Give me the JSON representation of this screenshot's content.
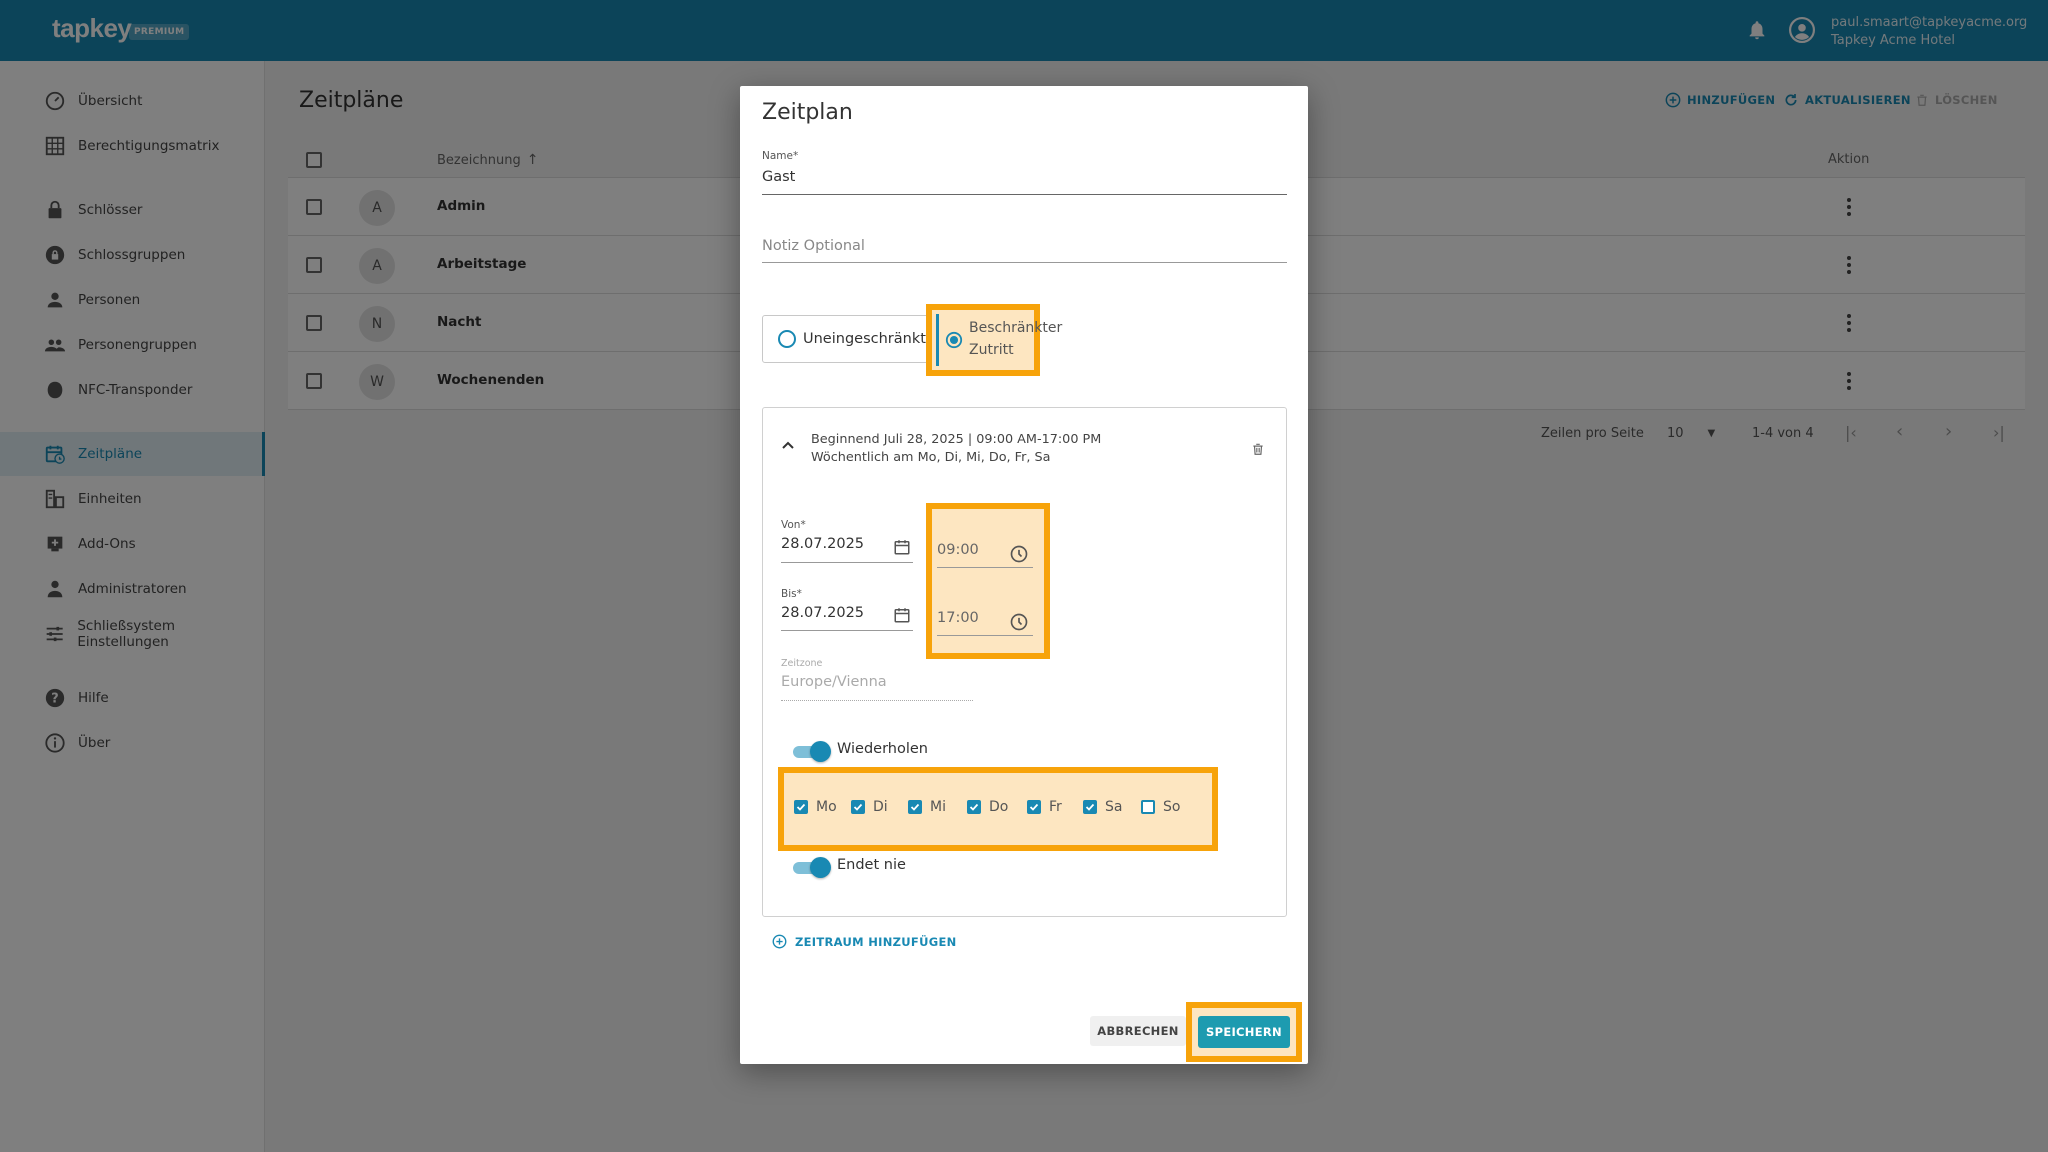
{
  "app": {
    "logo": "tapkey",
    "logo_badge": "PREMIUM",
    "user_email": "paul.smaart@tapkeyacme.org",
    "user_org": "Tapkey Acme Hotel"
  },
  "sidebar": {
    "items": [
      {
        "label": "Übersicht",
        "icon": "speedometer-icon"
      },
      {
        "label": "Berechtigungsmatrix",
        "icon": "grid-icon"
      },
      {
        "label": "Schlösser",
        "icon": "lock-icon"
      },
      {
        "label": "Schlossgruppen",
        "icon": "lock-group-icon"
      },
      {
        "label": "Personen",
        "icon": "person-icon"
      },
      {
        "label": "Personengruppen",
        "icon": "people-icon"
      },
      {
        "label": "NFC-Transponder",
        "icon": "transponder-icon"
      },
      {
        "label": "Zeitpläne",
        "icon": "calendar-clock-icon",
        "active": true
      },
      {
        "label": "Einheiten",
        "icon": "units-icon"
      },
      {
        "label": "Add-Ons",
        "icon": "addon-icon"
      },
      {
        "label": "Administratoren",
        "icon": "admin-icon"
      },
      {
        "label": "Schließsystem Einstellungen",
        "icon": "sliders-icon"
      },
      {
        "label": "Hilfe",
        "icon": "help-icon"
      },
      {
        "label": "Über",
        "icon": "info-icon"
      }
    ]
  },
  "main": {
    "title": "Zeitpläne",
    "actions": {
      "add": "HINZUFÜGEN",
      "refresh": "AKTUALISIEREN",
      "delete": "LÖSCHEN"
    },
    "columns": {
      "name": "Bezeichnung",
      "action": "Aktion"
    },
    "rows": [
      {
        "initial": "A",
        "name": "Admin"
      },
      {
        "initial": "A",
        "name": "Arbeitstage"
      },
      {
        "initial": "N",
        "name": "Nacht"
      },
      {
        "initial": "W",
        "name": "Wochenenden"
      }
    ],
    "pagination": {
      "rows_per_page_label": "Zeilen pro Seite",
      "rows_per_page": "10",
      "range": "1-4 von 4"
    }
  },
  "dialog": {
    "title": "Zeitplan",
    "name_label": "Name*",
    "name_value": "Gast",
    "note_placeholder": "Notiz Optional",
    "mode_unrestricted": "Uneingeschränkt",
    "mode_restricted_line1": "Beschränkter",
    "mode_restricted_line2": "Zutritt",
    "period": {
      "summary_line1": "Beginnend Juli 28, 2025 | 09:00 AM-17:00 PM",
      "summary_line2": "Wöchentlich am Mo, Di, Mi, Do, Fr, Sa",
      "from_label": "Von*",
      "from_date": "28.07.2025",
      "from_time": "09:00",
      "to_label": "Bis*",
      "to_date": "28.07.2025",
      "to_time": "17:00",
      "timezone_label": "Zeitzone",
      "timezone_value": "Europe/Vienna",
      "repeat_label": "Wiederholen",
      "days": [
        {
          "label": "Mo",
          "checked": true
        },
        {
          "label": "Di",
          "checked": true
        },
        {
          "label": "Mi",
          "checked": true
        },
        {
          "label": "Do",
          "checked": true
        },
        {
          "label": "Fr",
          "checked": true
        },
        {
          "label": "Sa",
          "checked": true
        },
        {
          "label": "So",
          "checked": false
        }
      ],
      "ends_never_label": "Endet nie"
    },
    "add_period": "ZEITRAUM HINZUFÜGEN",
    "cancel": "ABBRECHEN",
    "save": "SPEICHERN"
  },
  "colors": {
    "brand": "#1989b3",
    "highlight": "#f7a30a",
    "save": "#1d9bb0"
  }
}
